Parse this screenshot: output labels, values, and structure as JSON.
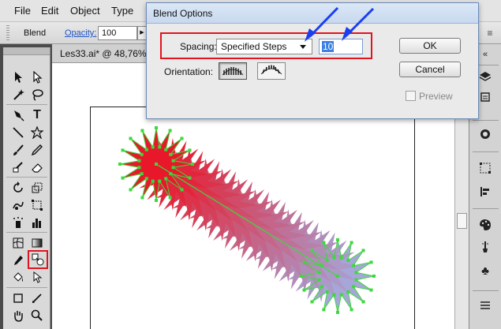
{
  "menubar": {
    "items": [
      "File",
      "Edit",
      "Object",
      "Type"
    ]
  },
  "controlbar": {
    "blend_label": "Blend",
    "opacity_label": "Opacity:",
    "opacity_value": "100"
  },
  "document": {
    "tab_title": "Les33.ai* @ 48,76% (R"
  },
  "dialog": {
    "title": "Blend Options",
    "spacing_label": "Spacing:",
    "spacing_value": "Specified Steps",
    "steps_value": "10",
    "orientation_label": "Orientation:",
    "ok_label": "OK",
    "cancel_label": "Cancel",
    "preview_label": "Preview",
    "preview_checked": false
  },
  "colors": {
    "start_star": "#e8182a",
    "end_star": "#a6a6d8",
    "path_handle": "#3cd93c",
    "highlight": "#e0141e",
    "annotation_arrow": "#1a3ff0"
  },
  "toolbox": {
    "icons": [
      "selection-tool-icon",
      "direct-selection-tool-icon",
      "magic-wand-icon",
      "lasso-icon",
      "pen-tool-icon",
      "type-tool-icon",
      "line-segment-icon",
      "star-tool-icon",
      "paintbrush-icon",
      "pencil-icon",
      "blob-brush-icon",
      "eraser-icon",
      "rotate-tool-icon",
      "scale-tool-icon",
      "warp-tool-icon",
      "free-transform-icon",
      "symbol-sprayer-icon",
      "column-graph-icon",
      "mesh-tool-icon",
      "gradient-tool-icon",
      "eyedropper-icon",
      "blend-tool-icon",
      "live-paint-bucket-icon",
      "live-paint-selection-icon",
      "artboard-tool-icon",
      "slice-tool-icon",
      "hand-tool-icon",
      "zoom-tool-icon"
    ],
    "highlighted": "blend-tool-icon"
  },
  "right_dock": {
    "icons": [
      "panel-expand-icon",
      "layers-icon",
      "appearance-icon",
      "stroke-icon",
      "align-icon",
      "transform-icon",
      "color-guide-icon",
      "brushes-icon",
      "symbols-icon",
      "swatch-libraries-icon"
    ]
  }
}
